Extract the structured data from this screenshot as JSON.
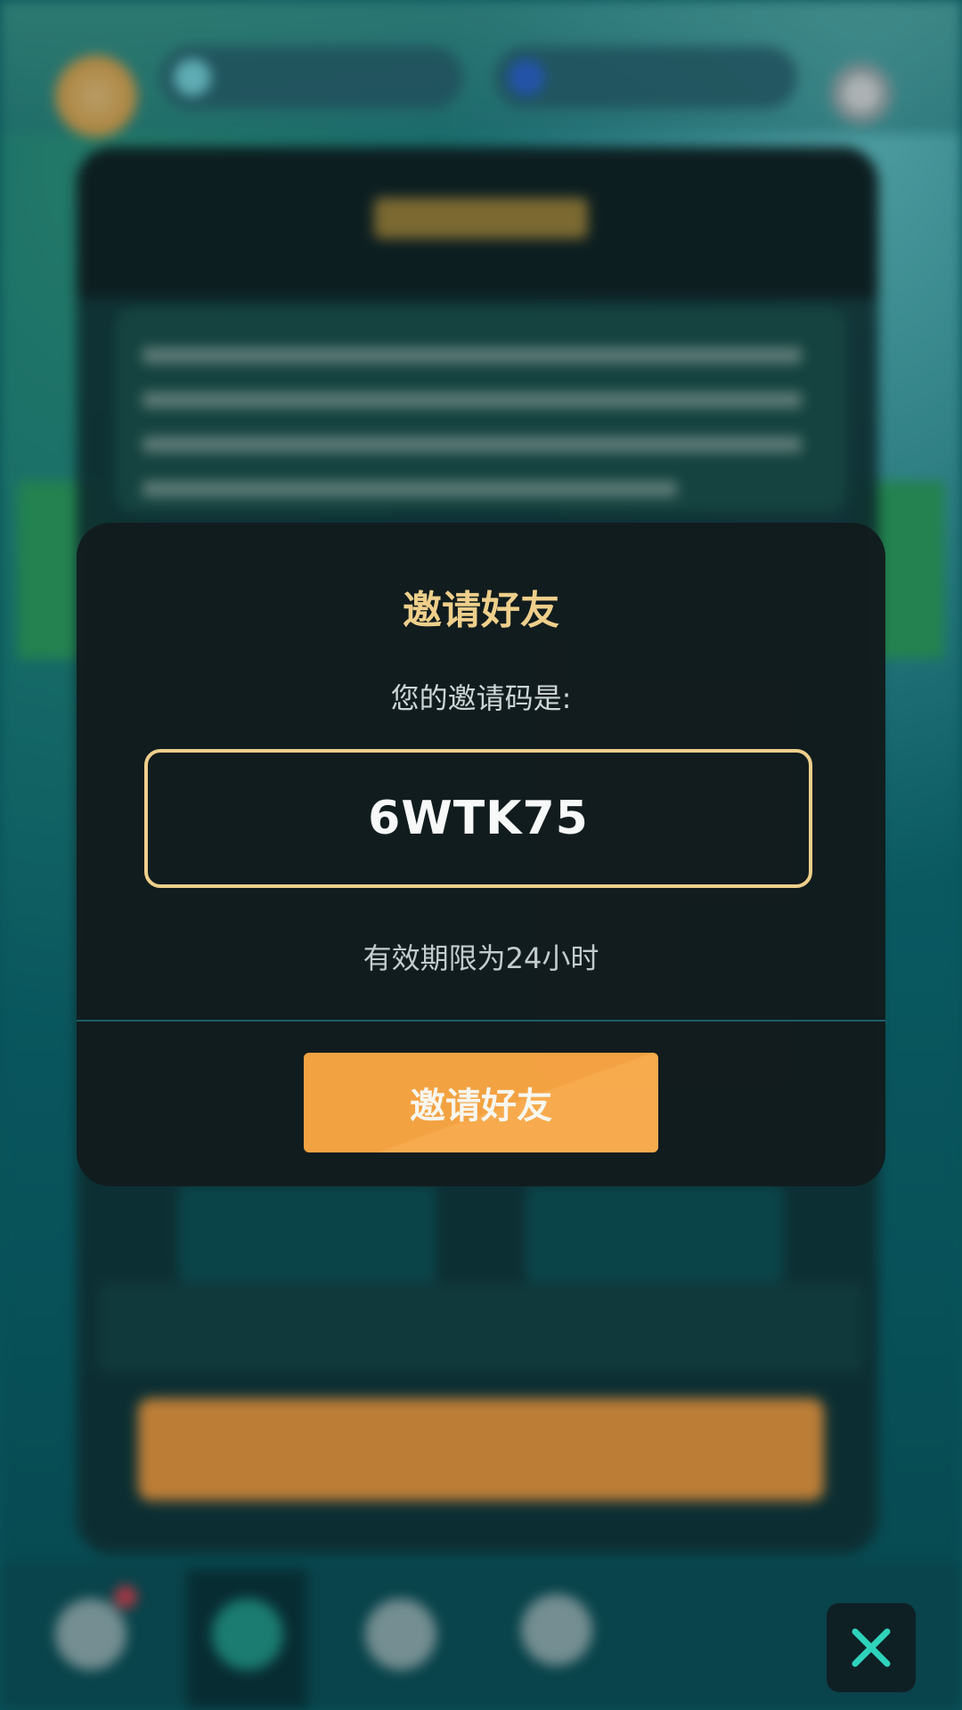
{
  "modal": {
    "title": "邀请好友",
    "code_label": "您的邀请码是:",
    "invite_code": "6WTK75",
    "expire_text": "有效期限为24小时",
    "invite_button_label": "邀请好友"
  },
  "icons": {
    "close": "close-icon"
  },
  "colors": {
    "accent_gold": "#f6d58e",
    "button_orange": "#fba643",
    "close_icon": "#2fd3bb",
    "modal_bg": "#121c1e"
  }
}
